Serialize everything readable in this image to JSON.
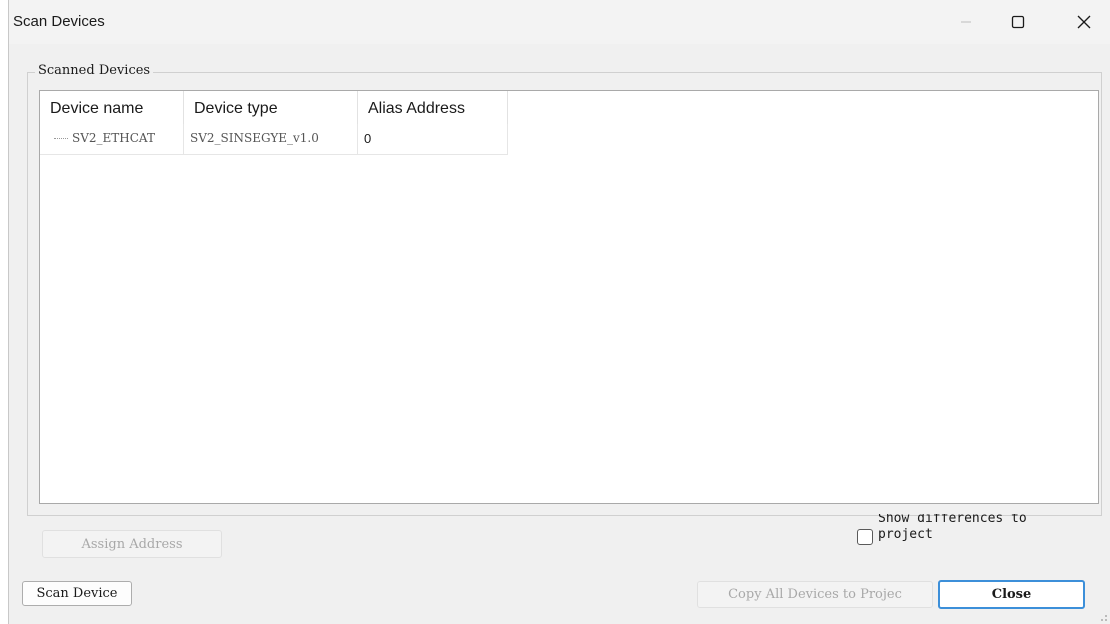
{
  "window": {
    "title": "Scan Devices",
    "controls": {
      "minimize_icon": "minimize-icon",
      "maximize_icon": "maximize-icon",
      "close_icon": "close-icon"
    }
  },
  "scanned_devices": {
    "group_label": "Scanned Devices",
    "columns": [
      "Device name",
      "Device type",
      "Alias Address"
    ],
    "rows": [
      {
        "device_name": "SV2_ETHCAT",
        "device_type": "SV2_SINSEGYE_v1.0",
        "alias_address": "0"
      }
    ]
  },
  "buttons": {
    "assign_address": "Assign Address",
    "scan_device": "Scan Device",
    "copy_all": "Copy All Devices to Projec",
    "close": "Close"
  },
  "show_differences": {
    "label": "Show differences to project",
    "checked": false
  },
  "colors": {
    "default_button_border": "#3c8fd9",
    "window_bg": "#f0f0f0"
  }
}
